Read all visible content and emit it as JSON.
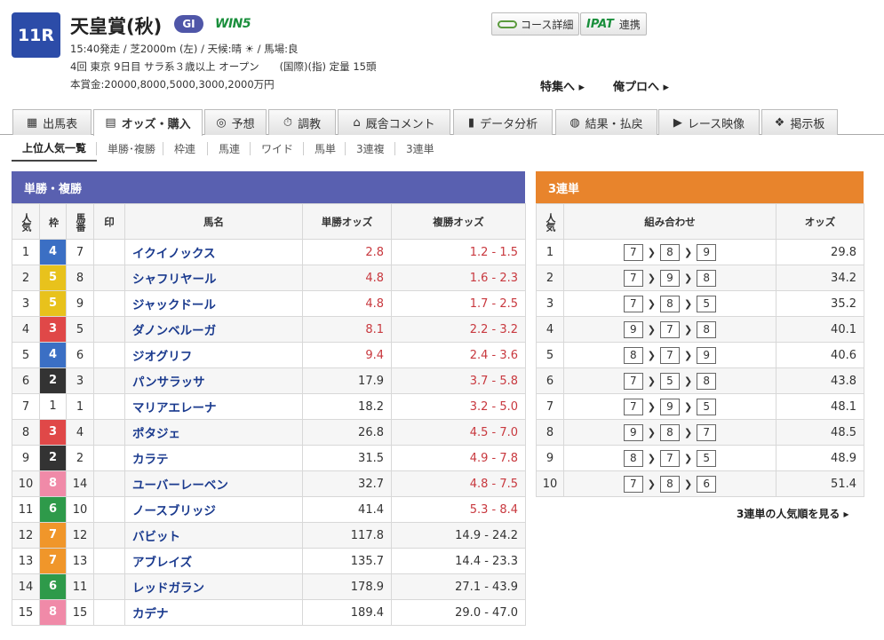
{
  "race": {
    "number": "11R",
    "name": "天皇賞(秋)",
    "grade": "GI",
    "win5": "WIN5",
    "line1": "15:40発走 / 芝2000m (左) / 天候:晴 ☀ / 馬場:良",
    "line2": "4回 東京 9日目 サラ系３歳以上 オープン　　(国際)(指) 定量 15頭",
    "line3": "本賞金:20000,8000,5000,3000,2000万円"
  },
  "header_buttons": {
    "course": "コース詳細",
    "ipat_logo": "IPAT",
    "ipat": "連携"
  },
  "links": {
    "tokushu": "特集へ ▸",
    "orepro": "俺プロへ ▸"
  },
  "tabs": [
    {
      "label": "出馬表",
      "icon": "▦"
    },
    {
      "label": "オッズ・購入",
      "icon": "▤"
    },
    {
      "label": "予想",
      "icon": "◎"
    },
    {
      "label": "調教",
      "icon": "⏱"
    },
    {
      "label": "厩舎コメント",
      "icon": "⌂"
    },
    {
      "label": "データ分析",
      "icon": "▮"
    },
    {
      "label": "結果・払戻",
      "icon": "◍"
    },
    {
      "label": "レース映像",
      "icon": "▶"
    },
    {
      "label": "掲示板",
      "icon": "❖"
    }
  ],
  "subtabs": [
    "上位人気一覧",
    "単勝･複勝",
    "枠連",
    "馬連",
    "ワイド",
    "馬単",
    "3連複",
    "3連単"
  ],
  "left": {
    "title": "単勝・複勝",
    "headers": [
      "人気",
      "枠",
      "馬番",
      "印",
      "馬名",
      "単勝オッズ",
      "複勝オッズ"
    ],
    "frame_colors": {
      "1": "#ffffff",
      "2": "#333333",
      "3": "#e04848",
      "4": "#3b6fc4",
      "5": "#e8c21c",
      "6": "#2e9a4a",
      "7": "#f0962a",
      "8": "#f08aa8"
    },
    "rows": [
      {
        "rank": "1",
        "frame": "4",
        "num": "7",
        "name": "イクイノックス",
        "win": "2.8",
        "place": "1.2 - 1.5",
        "win_red": true,
        "place_red": true
      },
      {
        "rank": "2",
        "frame": "5",
        "num": "8",
        "name": "シャフリヤール",
        "win": "4.8",
        "place": "1.6 - 2.3",
        "win_red": true,
        "place_red": true
      },
      {
        "rank": "3",
        "frame": "5",
        "num": "9",
        "name": "ジャックドール",
        "win": "4.8",
        "place": "1.7 - 2.5",
        "win_red": true,
        "place_red": true
      },
      {
        "rank": "4",
        "frame": "3",
        "num": "5",
        "name": "ダノンベルーガ",
        "win": "8.1",
        "place": "2.2 - 3.2",
        "win_red": true,
        "place_red": true
      },
      {
        "rank": "5",
        "frame": "4",
        "num": "6",
        "name": "ジオグリフ",
        "win": "9.4",
        "place": "2.4 - 3.6",
        "win_red": true,
        "place_red": true
      },
      {
        "rank": "6",
        "frame": "2",
        "num": "3",
        "name": "パンサラッサ",
        "win": "17.9",
        "place": "3.7 - 5.8",
        "win_red": false,
        "place_red": true
      },
      {
        "rank": "7",
        "frame": "1",
        "num": "1",
        "name": "マリアエレーナ",
        "win": "18.2",
        "place": "3.2 - 5.0",
        "win_red": false,
        "place_red": true
      },
      {
        "rank": "8",
        "frame": "3",
        "num": "4",
        "name": "ポタジェ",
        "win": "26.8",
        "place": "4.5 - 7.0",
        "win_red": false,
        "place_red": true
      },
      {
        "rank": "9",
        "frame": "2",
        "num": "2",
        "name": "カラテ",
        "win": "31.5",
        "place": "4.9 - 7.8",
        "win_red": false,
        "place_red": true
      },
      {
        "rank": "10",
        "frame": "8",
        "num": "14",
        "name": "ユーバーレーベン",
        "win": "32.7",
        "place": "4.8 - 7.5",
        "win_red": false,
        "place_red": true
      },
      {
        "rank": "11",
        "frame": "6",
        "num": "10",
        "name": "ノースブリッジ",
        "win": "41.4",
        "place": "5.3 - 8.4",
        "win_red": false,
        "place_red": true
      },
      {
        "rank": "12",
        "frame": "7",
        "num": "12",
        "name": "バビット",
        "win": "117.8",
        "place": "14.9 - 24.2",
        "win_red": false,
        "place_red": false
      },
      {
        "rank": "13",
        "frame": "7",
        "num": "13",
        "name": "アブレイズ",
        "win": "135.7",
        "place": "14.4 - 23.3",
        "win_red": false,
        "place_red": false
      },
      {
        "rank": "14",
        "frame": "6",
        "num": "11",
        "name": "レッドガラン",
        "win": "178.9",
        "place": "27.1 - 43.9",
        "win_red": false,
        "place_red": false
      },
      {
        "rank": "15",
        "frame": "8",
        "num": "15",
        "name": "カデナ",
        "win": "189.4",
        "place": "29.0 - 47.0",
        "win_red": false,
        "place_red": false
      }
    ]
  },
  "right": {
    "title": "3連単",
    "headers": [
      "人気",
      "組み合わせ",
      "オッズ"
    ],
    "rows": [
      {
        "rank": "1",
        "combo": [
          "7",
          "8",
          "9"
        ],
        "odds": "29.8"
      },
      {
        "rank": "2",
        "combo": [
          "7",
          "9",
          "8"
        ],
        "odds": "34.2"
      },
      {
        "rank": "3",
        "combo": [
          "7",
          "8",
          "5"
        ],
        "odds": "35.2"
      },
      {
        "rank": "4",
        "combo": [
          "9",
          "7",
          "8"
        ],
        "odds": "40.1"
      },
      {
        "rank": "5",
        "combo": [
          "8",
          "7",
          "9"
        ],
        "odds": "40.6"
      },
      {
        "rank": "6",
        "combo": [
          "7",
          "5",
          "8"
        ],
        "odds": "43.8"
      },
      {
        "rank": "7",
        "combo": [
          "7",
          "9",
          "5"
        ],
        "odds": "48.1"
      },
      {
        "rank": "8",
        "combo": [
          "9",
          "8",
          "7"
        ],
        "odds": "48.5"
      },
      {
        "rank": "9",
        "combo": [
          "8",
          "7",
          "5"
        ],
        "odds": "48.9"
      },
      {
        "rank": "10",
        "combo": [
          "7",
          "8",
          "6"
        ],
        "odds": "51.4"
      }
    ],
    "more_link": "3連単の人気順を見る ▸"
  },
  "colors": {
    "left_header": "#5960b0",
    "right_header": "#e8842c",
    "race_badge": "#2c4ca8",
    "odds_red": "#c8383e",
    "horse_name": "#1a3a8e"
  }
}
